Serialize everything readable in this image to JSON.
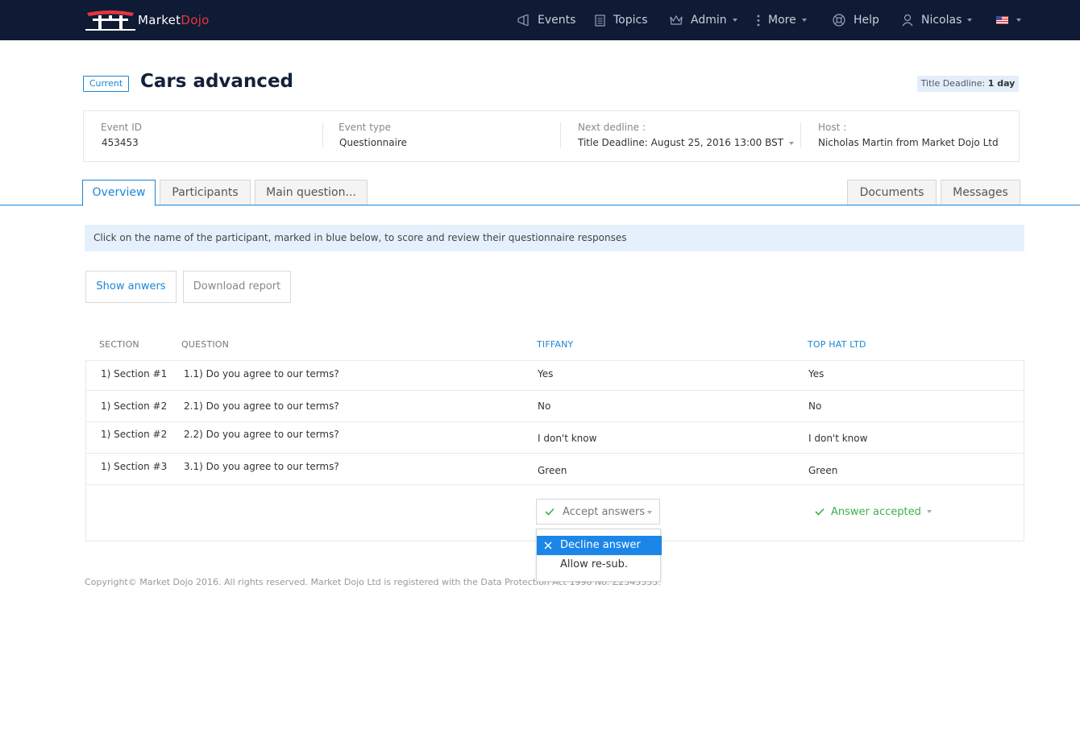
{
  "brand": {
    "name_part1": "Market",
    "name_part2": "Dojo",
    "accent": "#e8343f",
    "nav_bg": "#0f1b35",
    "primary": "#1b86d8"
  },
  "nav": {
    "events": "Events",
    "topics": "Topics",
    "admin": "Admin",
    "more": "More",
    "help": "Help",
    "user": "Nicolas",
    "language_icon": "us-flag-icon"
  },
  "event": {
    "status": "Current",
    "title": "Cars advanced",
    "deadline_label": "Title Deadline:",
    "deadline_value": "1 day",
    "info": [
      {
        "label": "Event ID",
        "value": "453453"
      },
      {
        "label": "Event type",
        "value": "Questionnaire"
      },
      {
        "label": "Next dedline :",
        "value": "Title Deadline: August 25, 2016 13:00 BST"
      },
      {
        "label": "Host :",
        "value": "Nicholas Martin from Market Dojo Ltd"
      }
    ]
  },
  "tabs": {
    "left": [
      "Overview",
      "Participants",
      "Main question..."
    ],
    "right": [
      "Documents",
      "Messages"
    ],
    "active": "Overview"
  },
  "notice": "Click on the name of the participant, marked in blue below, to score and review their questionnaire responses",
  "actions": {
    "show_answers": "Show anwers",
    "download_report": "Download report"
  },
  "table": {
    "headers": {
      "section": "SECTION",
      "question": "QUESTION",
      "p1": "TIFFANY",
      "p2": "TOP HAT LTD"
    },
    "rows": [
      {
        "section": "1) Section #1",
        "question": "1.1) Do you agree to our terms?",
        "p1": "Yes",
        "p2": "Yes"
      },
      {
        "section": "1) Section #2",
        "question": "2.1) Do you agree to our terms?",
        "p1": "No",
        "p2": "No"
      },
      {
        "section": "1) Section #2",
        "question": "2.2) Do you agree to our terms?",
        "p1": "I don't know",
        "p2": "I don't know"
      },
      {
        "section": "1) Section #3",
        "question": "3.1) Do you agree to our terms?",
        "p1": "Green",
        "p2": "Green"
      }
    ],
    "p1_action": "Accept answers",
    "p2_action": "Answer accepted"
  },
  "dropdown": {
    "items": [
      "Decline answer",
      "Allow re-sub."
    ],
    "highlighted": "Decline answer"
  },
  "footer": "Copyright© Market Dojo 2016. All rights reserved. Market Dojo Ltd is registered with the Data Protection Act 1998 No. Z2345353."
}
